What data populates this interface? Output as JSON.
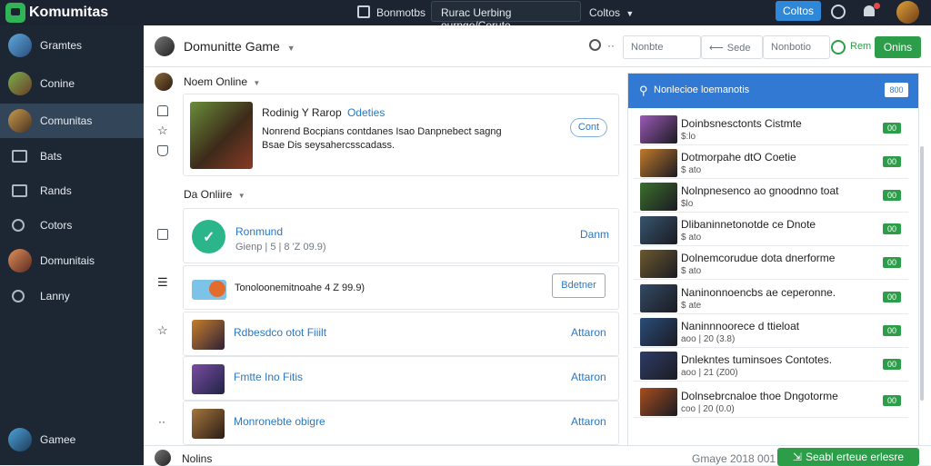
{
  "topbar": {
    "brand": "Komumitas",
    "nav_label": "Bonmotbs",
    "search_text": "Rurac Uerbing ourngo/Corute",
    "dropdown_label": "Coltos",
    "button_label": "Coltos"
  },
  "sidebar": {
    "items": [
      {
        "label": "Gramtes"
      },
      {
        "label": "Conine"
      },
      {
        "label": "Comunitas"
      },
      {
        "label": "Bats"
      },
      {
        "label": "Rands"
      },
      {
        "label": "Cotors"
      },
      {
        "label": "Domunitais"
      },
      {
        "label": "Lanny"
      }
    ],
    "bottom_label": "Gamee"
  },
  "header": {
    "title": "Domunitte Game",
    "input1": "Nonbte",
    "input2": "Sede",
    "input3": "Nonbotio",
    "icon_text": "Rem",
    "button_label": "Onins"
  },
  "section1": {
    "title": "Noem Online",
    "card_title": "Rodinig Y Rarop",
    "card_title_link": "Rarop",
    "card_title_tail": "Odeties",
    "card_line1": "Nonrend Bocpians contdanes Isao Danpnebect sagng",
    "card_line2": "Bsae Dis seysahercsscadass.",
    "card_button": "Cont"
  },
  "section2": {
    "title": "Da Onliire",
    "item1_title": "Ronmund",
    "item1_sub": "Gienp | 5 | 8 'Z 09.9)",
    "item1_action": "Danm",
    "item2_title": "Tonoloonemitnoahe 4 Z 99.9)",
    "item2_button": "Bdetner",
    "list": [
      {
        "title": "Rdbesdco otot Fiiilt",
        "action": "Attaron"
      },
      {
        "title": "Fmtte Ino Fitis",
        "action": "Attaron"
      },
      {
        "title": "Monronebte obigre",
        "action": "Attaron"
      }
    ]
  },
  "right_panel": {
    "title": "Nonlecioe loemanotis",
    "button_label": "800",
    "items": [
      {
        "title": "Doinbsnesctonts Cistmte",
        "sub": "$:lo",
        "badge": "00",
        "accent": "#9b59b6"
      },
      {
        "title": "Dotmorpahe dtO Coetie",
        "sub": "$ ato",
        "badge": "00",
        "accent": "#c0792a"
      },
      {
        "title": "Nolnpnesenco ao gnoodnno toat",
        "sub": "$lo",
        "badge": "00",
        "accent": "#3b6f2c"
      },
      {
        "title": "Dlibaninnetonotde ce Dnote",
        "sub": "$ ato",
        "badge": "00",
        "accent": "#37556e"
      },
      {
        "title": "Dolnemcorudue dota dnerforme",
        "sub": "$ ato",
        "badge": "00",
        "accent": "#6b5a2e"
      },
      {
        "title": "Naninonnoencbs ae ceperonne.",
        "sub": "$ ate",
        "badge": "00",
        "accent": "#344a64"
      },
      {
        "title": "Naninnnoorece d ttieloat",
        "sub": "aoo | 20 (3.8)",
        "badge": "00",
        "accent": "#2a4d7a"
      },
      {
        "title": "Dnlekntes tuminsoes Contotes.",
        "sub": "aoo | 21 (Z00)",
        "badge": "00",
        "accent": "#2e3c66"
      },
      {
        "title": "Dolnsebrcnaloe thoe Dngotorme",
        "sub": "coo | 20 (0.0)",
        "badge": "00",
        "accent": "#a64e1e"
      }
    ]
  },
  "footer": {
    "label": "Nolins",
    "status": "Gmaye  2018 001",
    "button_label": "Seabl erteue erlesre"
  }
}
